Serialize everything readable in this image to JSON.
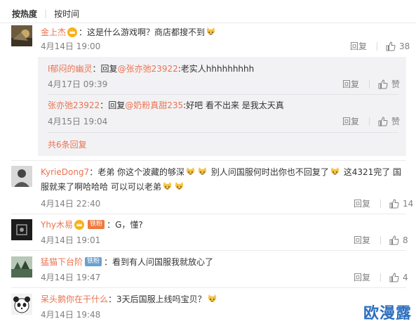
{
  "sort": {
    "hot": "按热度",
    "separator": "|",
    "time": "按时间"
  },
  "actions": {
    "reply": "回复",
    "like_word": "赞"
  },
  "comments": [
    {
      "user": "金上杰",
      "text": "：这是什么游戏啊？商店都搜不到",
      "date": "4月14日 19:00",
      "likes": "38",
      "replies": [
        {
          "user": "I郁闷的幽灵",
          "prefix": "：回复",
          "mention": "@张亦弛23922",
          "text": ":老实人hhhhhhhhh",
          "date": "4月17日 09:39",
          "likes": "赞"
        },
        {
          "user": "张亦弛23922",
          "prefix": "：回复",
          "mention": "@奶粉真甜235",
          "text": ":好吧 看不出来 是我太天真",
          "date": "4月15日 19:04",
          "likes": "赞"
        }
      ],
      "more_replies": "共6条回复"
    },
    {
      "user": "KyrieDong7",
      "text_line1_a": "：老弟 你这个波藏的够深",
      "text_line1_b": "别人问国服何时出你也不回复了",
      "text_line1_c": "这4321完了 国",
      "text_line2": "服就来了啊哈哈哈 可以可以老弟",
      "date": "4月14日 22:40",
      "likes": "14"
    },
    {
      "user": "Yhy木易",
      "badge": "铁粉",
      "text": "：G，懂?",
      "date": "4月14日 19:01",
      "likes": "8"
    },
    {
      "user": "猛猫下台阶",
      "badge": "铁粉",
      "text": "：看到有人问国服我就放心了",
      "date": "4月14日 19:47",
      "likes": "4"
    },
    {
      "user": "呆头鹅你在干什么",
      "text": "：3天后国服上线吗宝贝？",
      "date": "4月14日 19:48",
      "likes": ""
    }
  ],
  "watermark": "欧漫露",
  "colors": {
    "username": "#eb7350",
    "meta": "#808080",
    "reply_bg": "#f2f2f5",
    "watermark": "#2c6fbf"
  },
  "icons": {
    "like": "thumbs-up-icon",
    "emoji": "cat-face-emoji",
    "vip": "vip-crown-icon"
  }
}
